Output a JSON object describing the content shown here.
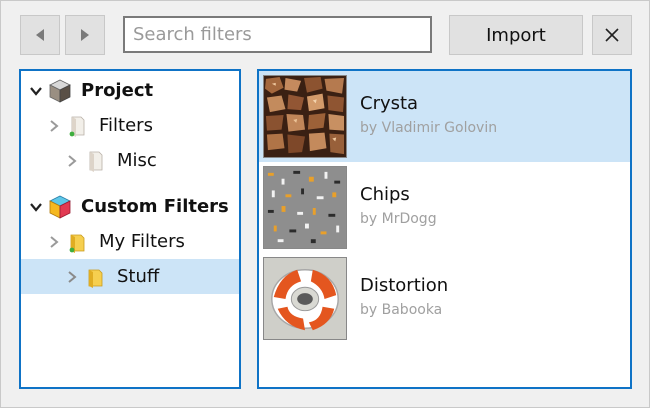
{
  "toolbar": {
    "back_icon": "chevron-left-icon",
    "forward_icon": "chevron-right-icon",
    "search_placeholder": "Search filters",
    "search_value": "",
    "import_label": "Import",
    "close_icon": "close-icon"
  },
  "tree": {
    "items": [
      {
        "label": "Project",
        "icon": "cube-icon",
        "expanded": true,
        "bold": true
      },
      {
        "label": "Filters",
        "icon": "file-icon",
        "expanded": false,
        "bold": false
      },
      {
        "label": "Misc",
        "icon": "file-icon",
        "expanded": false,
        "bold": false
      },
      {
        "label": "Custom Filters",
        "icon": "color-cube-icon",
        "expanded": true,
        "bold": true
      },
      {
        "label": "My Filters",
        "icon": "folder-icon",
        "expanded": false,
        "bold": false
      },
      {
        "label": "Stuff",
        "icon": "folder-icon",
        "expanded": false,
        "bold": false,
        "selected": true
      }
    ]
  },
  "filters": {
    "items": [
      {
        "name": "Crysta",
        "author": "by Vladimir Golovin",
        "selected": true
      },
      {
        "name": "Chips",
        "author": "by MrDogg"
      },
      {
        "name": "Distortion",
        "author": "by Babooka"
      }
    ]
  },
  "colors": {
    "accent": "#0f73c6",
    "selection": "#cce4f7",
    "background": "#f0f0f0"
  }
}
